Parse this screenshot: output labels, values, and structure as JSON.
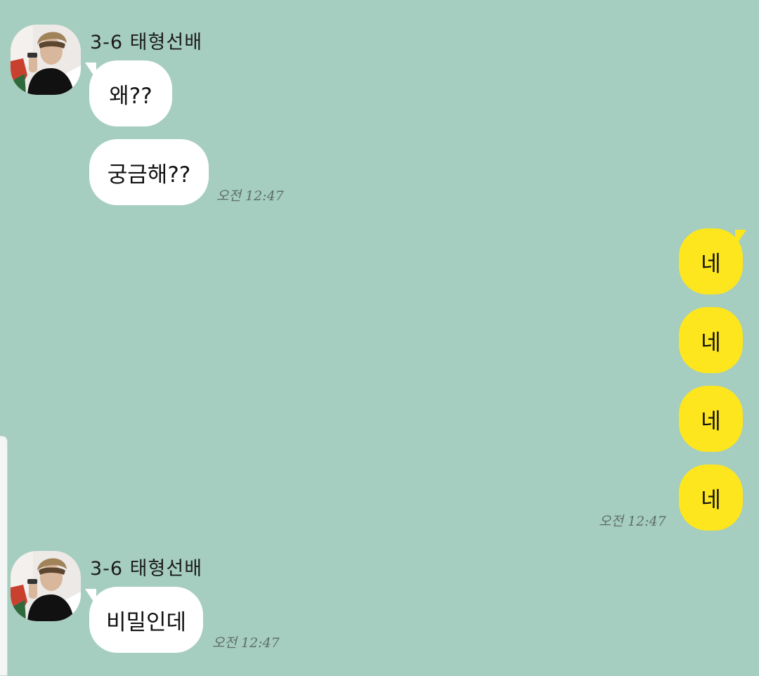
{
  "chat": {
    "background_color": "#a5cdc0",
    "incoming_bubble_color": "#ffffff",
    "outgoing_bubble_color": "#fde61d",
    "groups": [
      {
        "direction": "incoming",
        "sender": "3-6 태형선배",
        "avatar": "profile-photo",
        "messages": [
          "왜??",
          "궁금해??"
        ],
        "time": "오전 12:47"
      },
      {
        "direction": "outgoing",
        "messages": [
          "네",
          "네",
          "네",
          "네"
        ],
        "time": "오전 12:47"
      },
      {
        "direction": "incoming",
        "sender": "3-6 태형선배",
        "avatar": "profile-photo",
        "messages": [
          "비밀인데"
        ],
        "time": "오전 12:47"
      }
    ]
  }
}
